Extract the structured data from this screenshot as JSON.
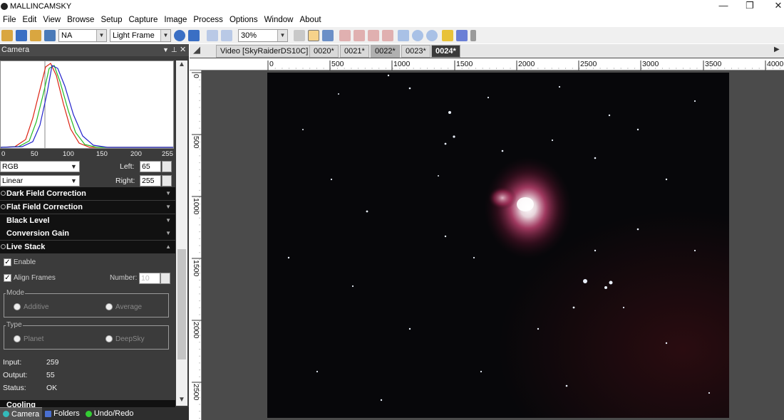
{
  "window": {
    "title": "MALLINCAMSKY",
    "controls": [
      "—",
      "❐",
      "✕"
    ]
  },
  "menu": [
    "File",
    "Edit",
    "View",
    "Browse",
    "Setup",
    "Capture",
    "Image",
    "Process",
    "Options",
    "Window",
    "About"
  ],
  "toolbar": {
    "camera_select": "NA",
    "frame_type": "Light Frame",
    "zoom": "30%"
  },
  "panel": {
    "title": "Camera",
    "histogram_ticks": [
      "0",
      "50",
      "100",
      "150",
      "200",
      "255"
    ],
    "color_mode": "RGB",
    "stretch_mode": "Linear",
    "left_label": "Left:",
    "left_value": "65",
    "right_label": "Right:",
    "right_value": "255",
    "sections": [
      "Dark Field Correction",
      "Flat Field Correction",
      "Black Level",
      "Conversion Gain",
      "Live Stack"
    ],
    "live_stack": {
      "enable_label": "Enable",
      "enable_checked": true,
      "align_label": "Align Frames",
      "align_checked": true,
      "number_label": "Number:",
      "number_value": "10",
      "mode_title": "Mode",
      "mode_options": [
        "Additive",
        "Average"
      ],
      "type_title": "Type",
      "type_options": [
        "Planet",
        "DeepSky"
      ],
      "input_label": "Input:",
      "input_value": "259",
      "output_label": "Output:",
      "output_value": "55",
      "status_label": "Status:",
      "status_value": "OK"
    },
    "next_section": "Cooling"
  },
  "bottom_tabs": [
    "Camera",
    "Folders",
    "Undo/Redo"
  ],
  "doc_tabs": [
    "Video [SkyRaiderDS10C]",
    "0020*",
    "0021*",
    "0022*",
    "0023*",
    "0024*"
  ],
  "active_doc_tab": "0024*",
  "ruler_top": [
    "0",
    "500",
    "1000",
    "1500",
    "2000",
    "2500",
    "3000",
    "3500",
    "4000"
  ],
  "ruler_left": [
    "0",
    "500",
    "1000",
    "1500",
    "2000",
    "2500"
  ]
}
